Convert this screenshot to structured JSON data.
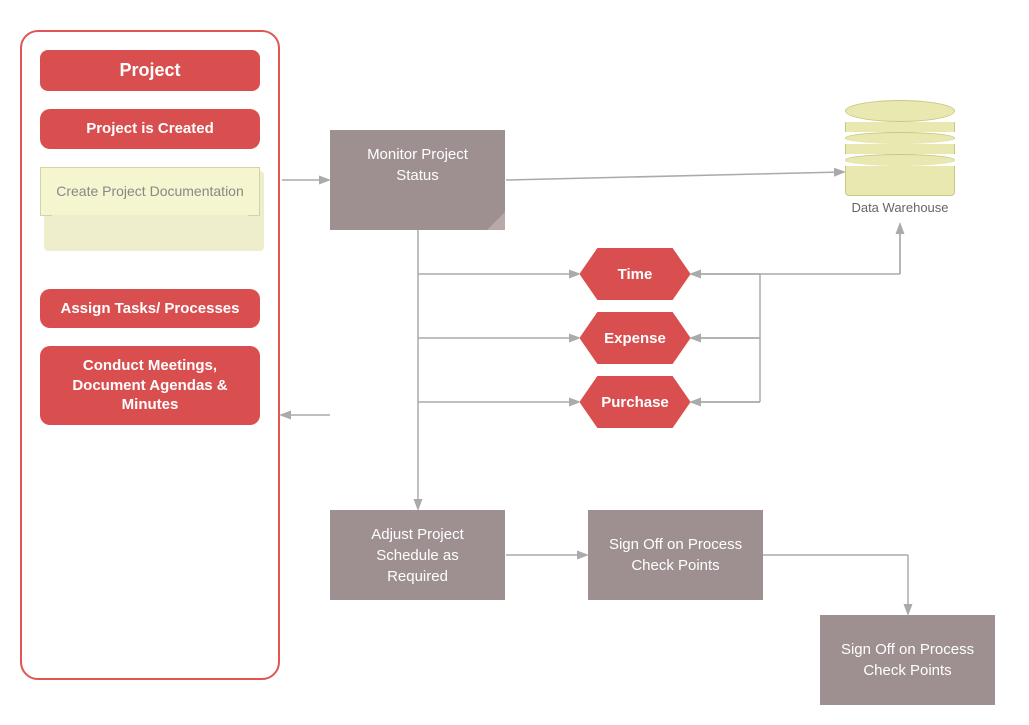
{
  "leftPanel": {
    "title": "Project",
    "items": [
      {
        "id": "project-created",
        "label": "Project is Created",
        "type": "red-rounded"
      },
      {
        "id": "create-docs",
        "label": "Create Project Documentation",
        "type": "doc"
      },
      {
        "id": "assign-tasks",
        "label": "Assign Tasks/\nProcesses",
        "type": "red-rounded"
      },
      {
        "id": "conduct-meetings",
        "label": "Conduct Meetings, Document Agendas & Minutes",
        "type": "red-rounded"
      }
    ]
  },
  "mainNodes": {
    "monitor": {
      "label": "Monitor Project\nStatus"
    },
    "adjustSchedule": {
      "label": "Adjust Project Schedule as Required"
    },
    "signOff1": {
      "label": "Sign Off on Process Check Points"
    },
    "signOff2": {
      "label": "Sign Off on Process Check Points"
    }
  },
  "hexNodes": {
    "time": {
      "label": "Time"
    },
    "expense": {
      "label": "Expense"
    },
    "purchase": {
      "label": "Purchase"
    }
  },
  "dataWarehouse": {
    "label": "Data Warehouse"
  }
}
